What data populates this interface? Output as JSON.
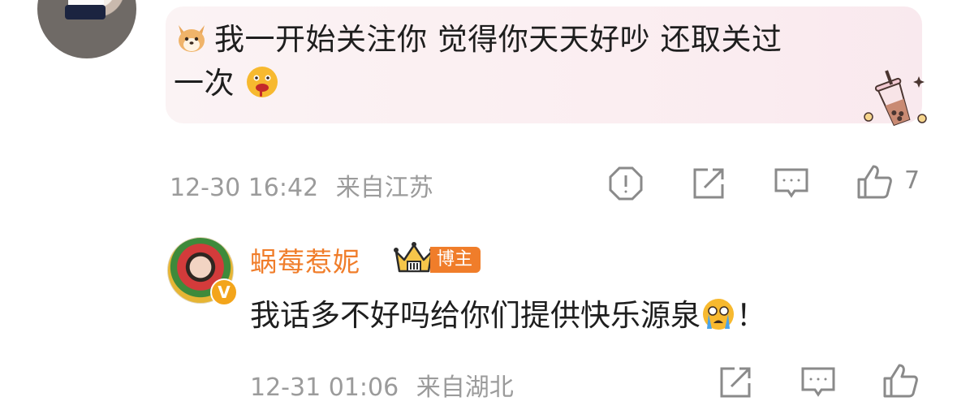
{
  "comment": {
    "text_line1": "我一开始关注你 觉得你天天好吵 还取关过",
    "text_line2": "一次",
    "timestamp": "12-30 16:42",
    "location": "来自江苏",
    "like_count": "7",
    "emojis": [
      "shiba-dog-emoji",
      "drooling-face-emoji"
    ],
    "sticker": "bubble-tea-sticker"
  },
  "reply": {
    "username": "蜗莓惹妮",
    "badge_label": "博主",
    "text": "我话多不好吗给你们提供快乐源泉",
    "text_suffix": "！",
    "emoji": "crying-face-emoji",
    "verified_mark": "V",
    "timestamp": "12-31 01:06",
    "location": "来自湖北"
  },
  "colors": {
    "username": "#f07d2a",
    "meta_text": "#9b9b9b",
    "bubble_bg": "#fbeef1",
    "verified": "#f3a51b"
  }
}
